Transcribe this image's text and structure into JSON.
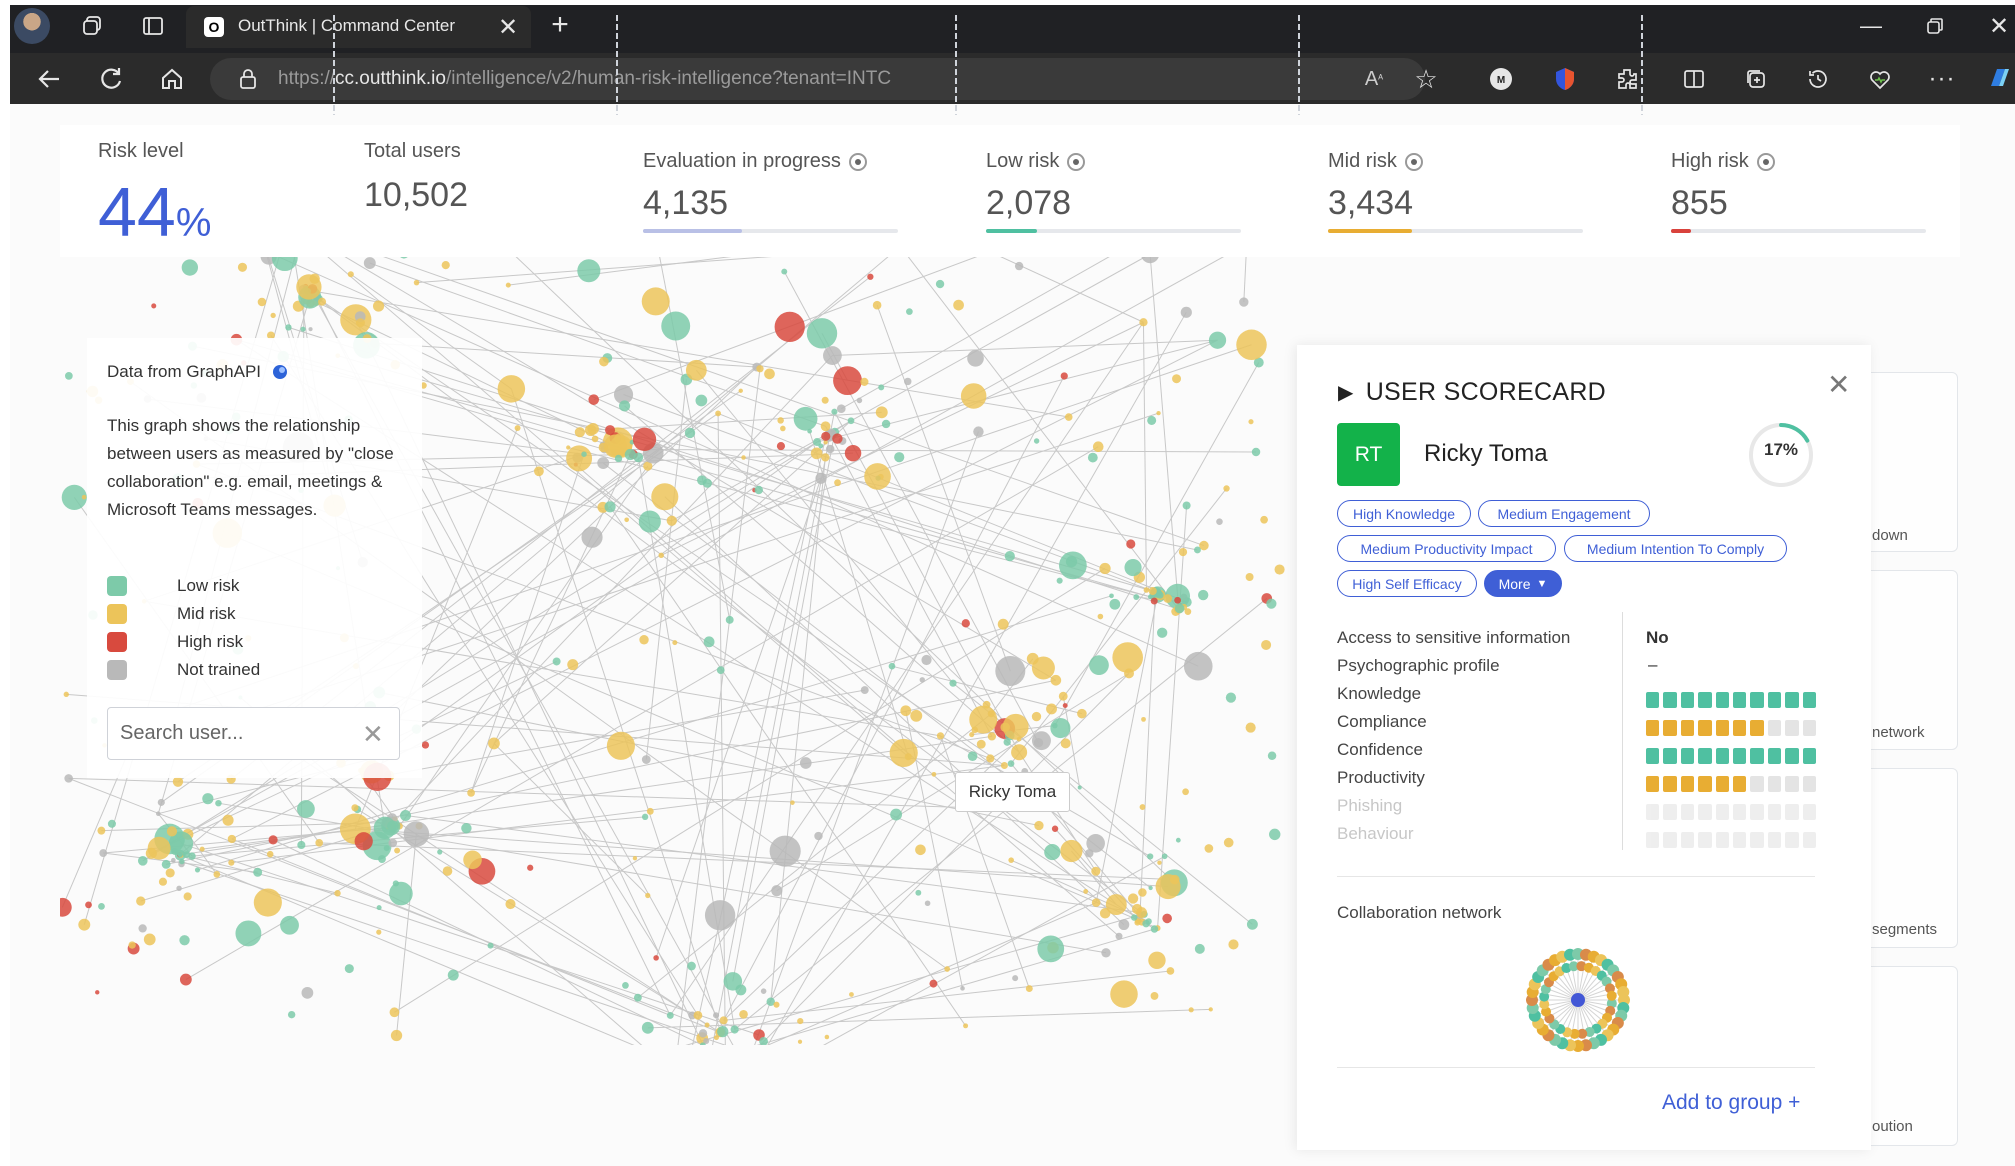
{
  "browser": {
    "tab_title": "OutThink | Command Center",
    "tab_favicon_letter": "O",
    "url_prefix": "https://",
    "url_host": "cc.outthink.io",
    "url_path": "/intelligence/v2/human-risk-intelligence?tenant=INTC"
  },
  "stats": {
    "risk_level": {
      "label": "Risk level",
      "value": "44",
      "unit": "%"
    },
    "total_users": {
      "label": "Total users",
      "value": "10,502"
    },
    "evaluation": {
      "label": "Evaluation in progress",
      "value": "4,135",
      "fraction": 0.39,
      "color": "#b9c0e6"
    },
    "low_risk": {
      "label": "Low risk",
      "value": "2,078",
      "fraction": 0.2,
      "color": "#4fc0a1"
    },
    "mid_risk": {
      "label": "Mid risk",
      "value": "3,434",
      "fraction": 0.33,
      "color": "#e8ad33"
    },
    "high_risk": {
      "label": "High risk",
      "value": "855",
      "fraction": 0.08,
      "color": "#d9423c"
    }
  },
  "legend": {
    "title": "Data from GraphAPI",
    "description": "This graph shows the relationship between users as measured by \"close collaboration\" e.g. email, meetings & Microsoft Teams messages.",
    "items": [
      {
        "label": "Low risk",
        "color": "#7dcaa9"
      },
      {
        "label": "Mid risk",
        "color": "#ecc45a"
      },
      {
        "label": "High risk",
        "color": "#d84a3e"
      },
      {
        "label": "Not trained",
        "color": "#b9b9b9"
      }
    ],
    "search_placeholder": "Search user..."
  },
  "graph": {
    "tooltip": "Ricky Toma"
  },
  "side_cards": {
    "labels": [
      "down",
      "network",
      "segments",
      "oution"
    ]
  },
  "scorecard": {
    "title": "USER SCORECARD",
    "initials": "RT",
    "name": "Ricky Toma",
    "risk_percent": "17%",
    "risk_fraction": 0.17,
    "tags": [
      "High Knowledge",
      "Medium Engagement",
      "Medium Productivity Impact",
      "Medium Intention To Comply",
      "High Self Efficacy"
    ],
    "more_label": "More",
    "attributes": {
      "sensitive": {
        "label": "Access to sensitive information",
        "value": "No"
      },
      "psychographic": {
        "label": "Psychographic profile",
        "value": "–"
      },
      "knowledge": {
        "label": "Knowledge",
        "filled": 10,
        "total": 10,
        "color": "#4fc0a1"
      },
      "compliance": {
        "label": "Compliance",
        "filled": 7,
        "total": 10,
        "color": "#e8ad33"
      },
      "confidence": {
        "label": "Confidence",
        "filled": 10,
        "total": 10,
        "color": "#4fc0a1"
      },
      "productivity": {
        "label": "Productivity",
        "filled": 6,
        "total": 10,
        "color": "#e8ad33"
      },
      "phishing": {
        "label": "Phishing",
        "filled": 0,
        "total": 10,
        "color": "#e4e4e4"
      },
      "behaviour": {
        "label": "Behaviour",
        "filled": 0,
        "total": 10,
        "color": "#e4e4e4"
      }
    },
    "collaboration_label": "Collaboration network",
    "add_group_label": "Add to group +"
  }
}
